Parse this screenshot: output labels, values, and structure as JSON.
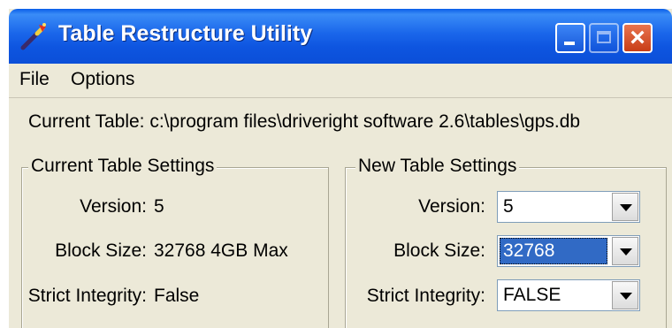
{
  "window": {
    "title": "Table Restructure Utility",
    "icon": "wand-icon"
  },
  "menu": {
    "items": [
      "File",
      "Options"
    ]
  },
  "current_table": {
    "label": "Current Table: c:\\program files\\driveright software 2.6\\tables\\gps.db"
  },
  "current_settings": {
    "legend": "Current Table Settings",
    "version_label": "Version:",
    "version_value": "5",
    "block_size_label": "Block Size:",
    "block_size_value": "32768 4GB Max",
    "strict_label": "Strict Integrity:",
    "strict_value": "False"
  },
  "new_settings": {
    "legend": "New Table Settings",
    "version_label": "Version:",
    "version_value": "5",
    "block_size_label": "Block Size:",
    "block_size_value": "32768",
    "strict_label": "Strict Integrity:",
    "strict_value": "FALSE"
  },
  "colors": {
    "title_bar": "#0b4fd8",
    "window_bg": "#ece9d8",
    "selection": "#316ac5",
    "close_button": "#c83d16"
  }
}
